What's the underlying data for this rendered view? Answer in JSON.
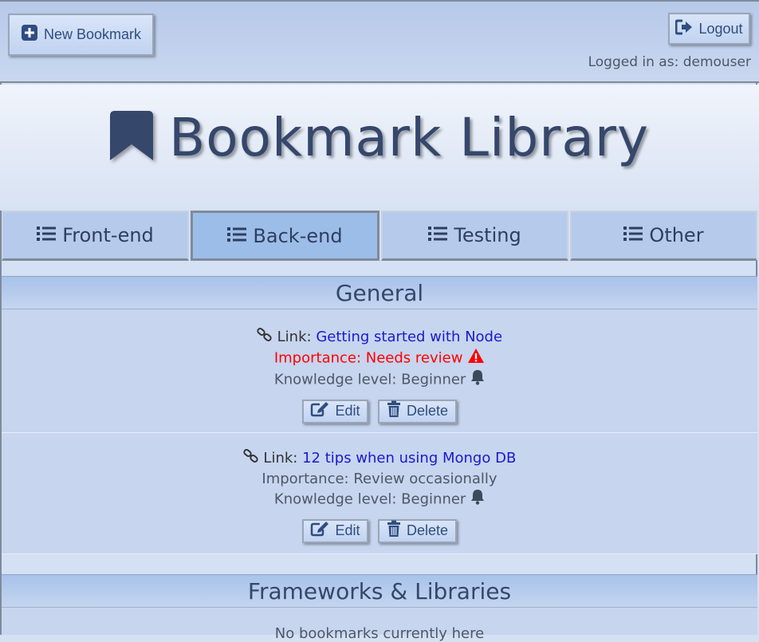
{
  "topbar": {
    "new_bookmark_label": "New Bookmark",
    "logout_label": "Logout",
    "logged_in_text": "Logged in as: demouser"
  },
  "header": {
    "title": "Bookmark Library"
  },
  "tabs": [
    {
      "label": "Front-end",
      "active": false
    },
    {
      "label": "Back-end",
      "active": true
    },
    {
      "label": "Testing",
      "active": false
    },
    {
      "label": "Other",
      "active": false
    }
  ],
  "sections": [
    {
      "title": "General",
      "bookmarks": [
        {
          "link_label": "Link:",
          "link_text": "Getting started with Node",
          "importance": "Importance: Needs review",
          "importance_alert": true,
          "knowledge": "Knowledge level: Beginner",
          "edit_label": "Edit",
          "delete_label": "Delete"
        },
        {
          "link_label": "Link:",
          "link_text": "12 tips when using Mongo DB",
          "importance": "Importance: Review occasionally",
          "importance_alert": false,
          "knowledge": "Knowledge level: Beginner",
          "edit_label": "Edit",
          "delete_label": "Delete"
        }
      ]
    },
    {
      "title": "Frameworks & Libraries",
      "empty_text": "No bookmarks currently here"
    }
  ],
  "colors": {
    "accent": "#35476b",
    "link": "#1a1acc",
    "alert": "#ff0000"
  },
  "icons": [
    "plus-square-icon",
    "logout-icon",
    "bookmark-icon",
    "list-icon",
    "link-icon",
    "warning-icon",
    "bell-icon",
    "edit-icon",
    "trash-icon"
  ]
}
